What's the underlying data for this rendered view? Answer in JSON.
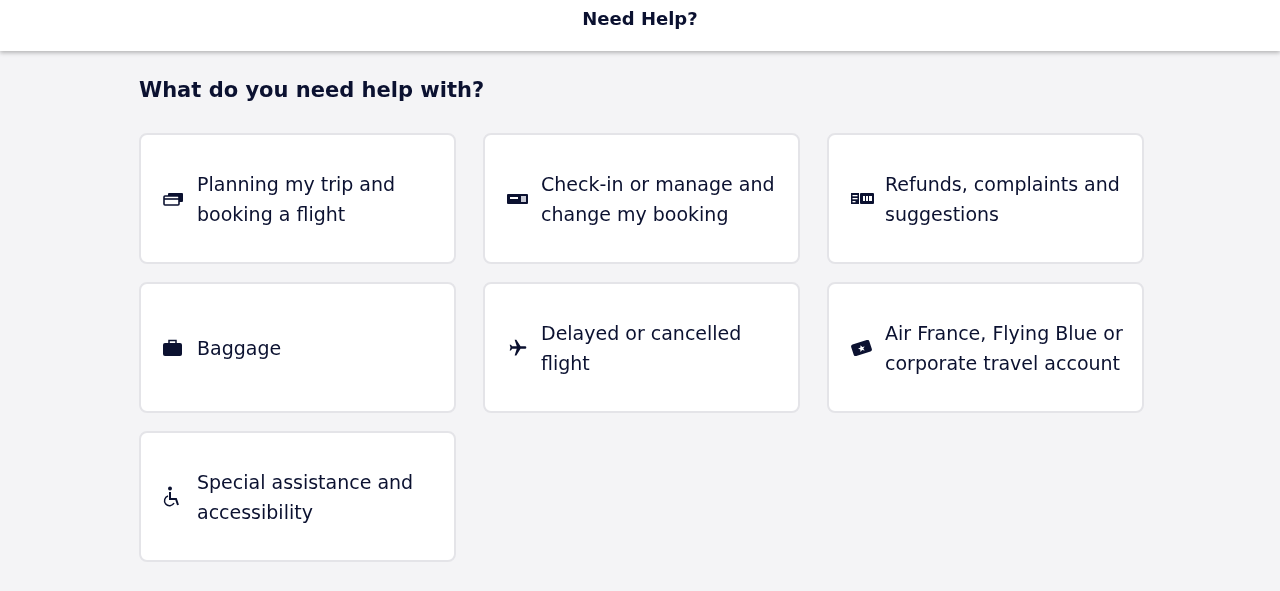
{
  "header": {
    "title": "Need Help?"
  },
  "heading": "What do you need help with?",
  "topics": [
    {
      "label": "Planning my trip and booking a flight"
    },
    {
      "label": "Check-in or manage and change my booking"
    },
    {
      "label": "Refunds, complaints and suggestions"
    },
    {
      "label": "Baggage"
    },
    {
      "label": "Delayed or cancelled flight"
    },
    {
      "label": "Air France, Flying Blue or corporate travel account"
    },
    {
      "label": "Special assistance and accessibility"
    }
  ]
}
